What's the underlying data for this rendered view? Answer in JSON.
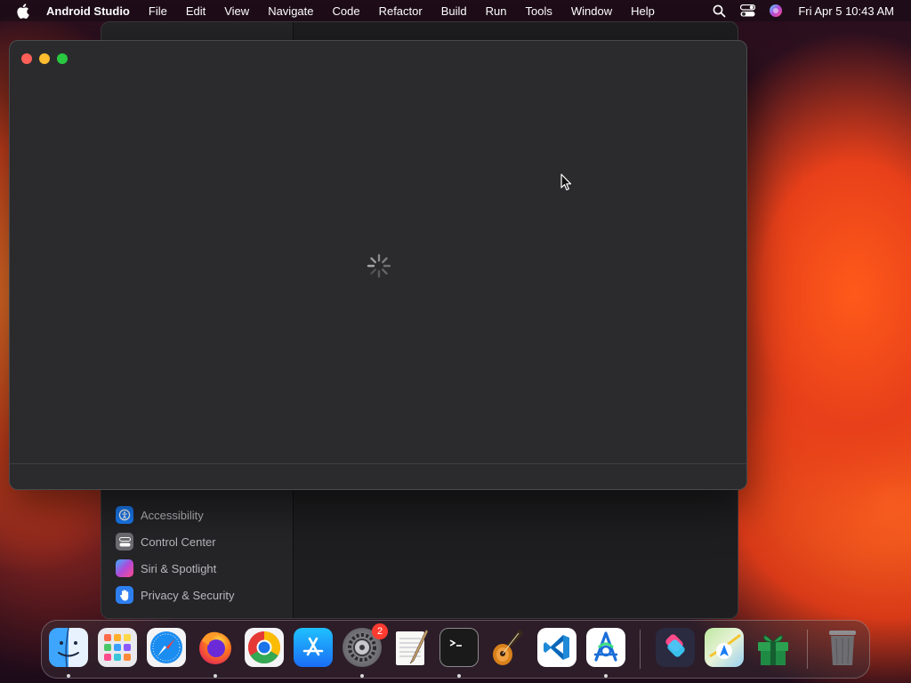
{
  "menubar": {
    "app_name": "Android Studio",
    "menus": [
      "File",
      "Edit",
      "View",
      "Navigate",
      "Code",
      "Refactor",
      "Build",
      "Run",
      "Tools",
      "Window",
      "Help"
    ],
    "clock": "Fri Apr 5  10:43 AM"
  },
  "settings_sidebar": {
    "items": [
      {
        "label": "Accessibility",
        "icon": "accessibility-icon",
        "color": "#1a7cf5"
      },
      {
        "label": "Control Center",
        "icon": "control-center-icon",
        "color": "#6e6e72"
      },
      {
        "label": "Siri & Spotlight",
        "icon": "siri-icon",
        "color": "#b04ad8"
      },
      {
        "label": "Privacy & Security",
        "icon": "hand-icon",
        "color": "#2d7ff0"
      }
    ]
  },
  "loading_window": {
    "state": "loading"
  },
  "dock": {
    "apps": [
      {
        "name": "Finder",
        "running": true
      },
      {
        "name": "Launchpad",
        "running": false
      },
      {
        "name": "Safari",
        "running": false
      },
      {
        "name": "Firefox",
        "running": true
      },
      {
        "name": "Chrome",
        "running": false
      },
      {
        "name": "App Store",
        "running": false
      },
      {
        "name": "System Settings",
        "running": true,
        "badge": "2"
      },
      {
        "name": "TextEdit",
        "running": false
      },
      {
        "name": "Terminal",
        "running": true
      },
      {
        "name": "GarageBand",
        "running": false
      },
      {
        "name": "Visual Studio Code",
        "running": false
      },
      {
        "name": "Android Studio",
        "running": true
      },
      {
        "name": "Shortcuts",
        "running": false
      },
      {
        "name": "Maps",
        "running": false
      },
      {
        "name": "Gift",
        "running": false
      },
      {
        "name": "Trash",
        "running": false
      }
    ]
  }
}
